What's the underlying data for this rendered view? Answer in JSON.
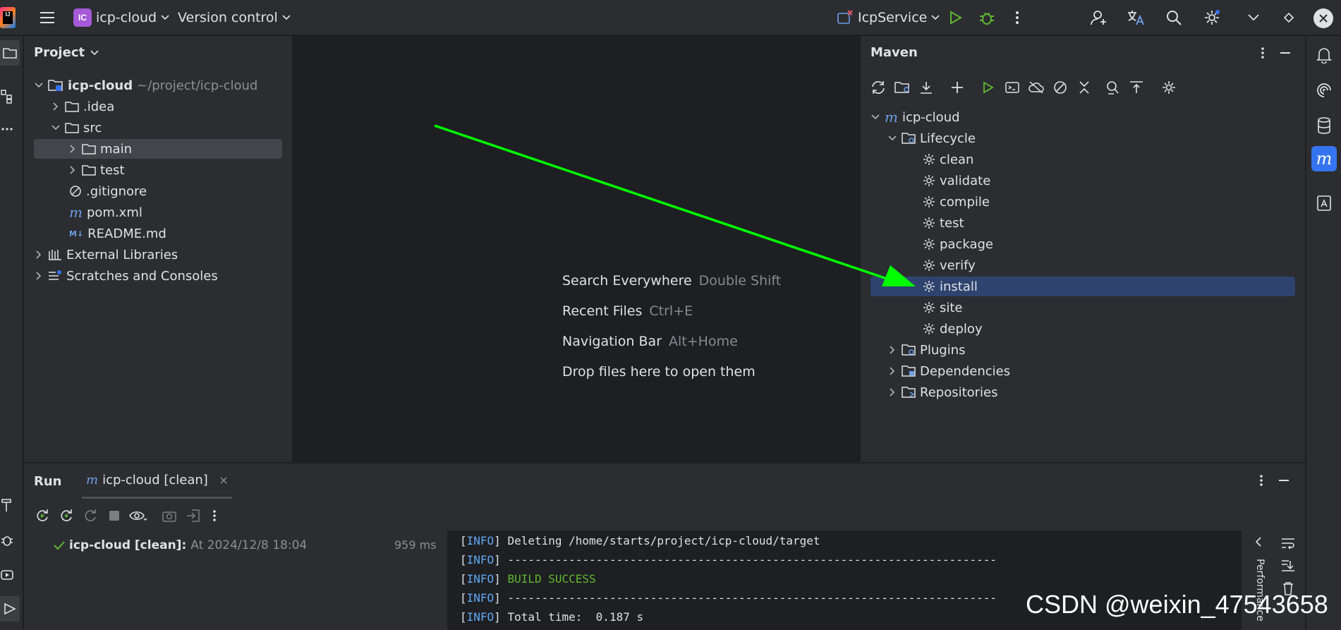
{
  "titlebar": {
    "project_badge": "IC",
    "project_name": "icp-cloud",
    "vcs": "Version control",
    "run_config": "IcpService"
  },
  "project_panel": {
    "title": "Project",
    "tree": [
      {
        "label": "icp-cloud",
        "hint": "~/project/icp-cloud"
      },
      {
        "label": ".idea"
      },
      {
        "label": "src"
      },
      {
        "label": "main"
      },
      {
        "label": "test"
      },
      {
        "label": ".gitignore"
      },
      {
        "label": "pom.xml"
      },
      {
        "label": "README.md"
      },
      {
        "label": "External Libraries"
      },
      {
        "label": "Scratches and Consoles"
      }
    ]
  },
  "editor": {
    "hints": [
      {
        "label": "Search Everywhere",
        "key": "Double Shift"
      },
      {
        "label": "Recent Files",
        "key": "Ctrl+E"
      },
      {
        "label": "Navigation Bar",
        "key": "Alt+Home"
      },
      {
        "label": "Drop files here to open them",
        "key": ""
      }
    ]
  },
  "maven": {
    "title": "Maven",
    "root": "icp-cloud",
    "lifecycle": "Lifecycle",
    "phases": [
      "clean",
      "validate",
      "compile",
      "test",
      "package",
      "verify",
      "install",
      "site",
      "deploy"
    ],
    "selected_phase": "install",
    "groups": [
      "Plugins",
      "Dependencies",
      "Repositories"
    ]
  },
  "run": {
    "title": "Run",
    "tab": "icp-cloud [clean]",
    "result_name": "icp-cloud [clean]:",
    "result_time": "At 2024/12/8 18:04",
    "duration": "959 ms",
    "console": [
      {
        "tag": "INFO",
        "text": " Deleting /home/starts/project/icp-cloud/target"
      },
      {
        "tag": "INFO",
        "text": " ------------------------------------------------------------------------"
      },
      {
        "tag": "INFO",
        "text": " BUILD SUCCESS"
      },
      {
        "tag": "INFO",
        "text": " ------------------------------------------------------------------------"
      },
      {
        "tag": "INFO",
        "text": " Total time:  0.187 s"
      }
    ],
    "side_tab": "Performance"
  },
  "colors": {
    "accent": "#3574f0",
    "success": "#5fb832",
    "arrow": "#00ff00",
    "info": "#5fa9f5"
  },
  "watermark": "CSDN @weixin_47543658"
}
